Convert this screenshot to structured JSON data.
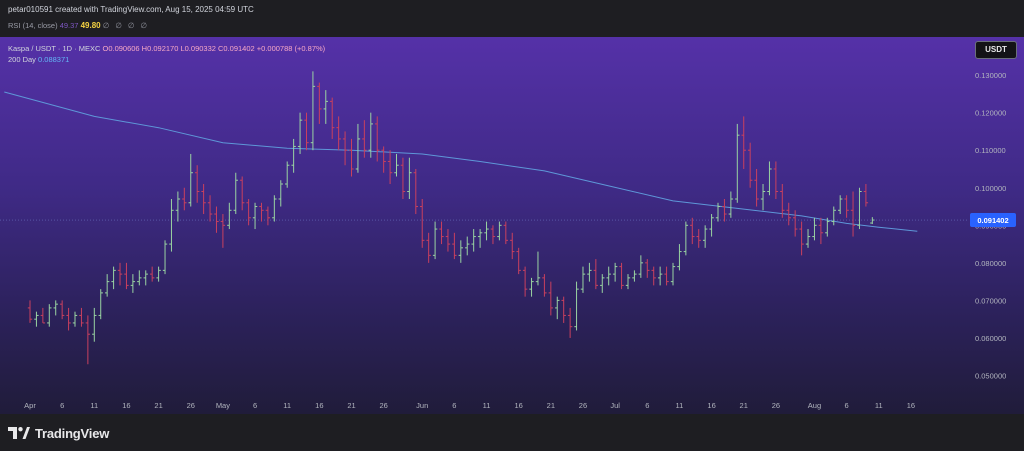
{
  "header": {
    "credit": "petar010591 created with TradingView.com, Aug 15, 2025 04:59 UTC",
    "rsi_label": "RSI (14, close)",
    "rsi_value_1": "49.37",
    "rsi_value_2": "49.80",
    "rsi_empty": "∅ ∅ ∅ ∅"
  },
  "legend": {
    "symbol": "Kaspa / USDT · 1D · MEXC",
    "ohlc": "O0.090606 H0.092170 L0.090332 C0.091402 +0.000788 (+0.87%)",
    "ma_label": "200 Day",
    "ma_value": "0.088371"
  },
  "currency_button": "USDT",
  "footer": {
    "brand": "TradingView"
  },
  "colors": {
    "bull": "#9ad4a2",
    "bear": "#c9405e",
    "ma": "#5e97d8",
    "price_tag": "#2962ff",
    "axis_text": "#b2b5be"
  },
  "chart_data": {
    "type": "ohlc",
    "title": "Kaspa / USDT · 1D · MEXC",
    "ylim": [
      0.045,
      0.135
    ],
    "y_ticks": [
      "0.050000",
      "0.060000",
      "0.070000",
      "0.080000",
      "0.090000",
      "0.100000",
      "0.110000",
      "0.120000",
      "0.130000"
    ],
    "y_tick_values": [
      0.05,
      0.06,
      0.07,
      0.08,
      0.09,
      0.1,
      0.11,
      0.12,
      0.13
    ],
    "x_ticks": [
      "Apr",
      "6",
      "11",
      "16",
      "21",
      "26",
      "May",
      "6",
      "11",
      "16",
      "21",
      "26",
      "Jun",
      "6",
      "11",
      "16",
      "21",
      "26",
      "Jul",
      "6",
      "11",
      "16",
      "21",
      "26",
      "Aug",
      "6",
      "11",
      "16"
    ],
    "x_tick_days": [
      0,
      5,
      10,
      15,
      20,
      25,
      30,
      35,
      40,
      45,
      50,
      55,
      61,
      66,
      71,
      76,
      81,
      86,
      91,
      96,
      101,
      106,
      111,
      116,
      122,
      127,
      132,
      137
    ],
    "last_price": "0.091402",
    "last_price_value": 0.091402,
    "ma_200": [
      [
        -4,
        0.1255
      ],
      [
        10,
        0.119
      ],
      [
        20,
        0.116
      ],
      [
        30,
        0.112
      ],
      [
        40,
        0.1105
      ],
      [
        50,
        0.11
      ],
      [
        61,
        0.109
      ],
      [
        70,
        0.107
      ],
      [
        80,
        0.1045
      ],
      [
        90,
        0.1005
      ],
      [
        100,
        0.0965
      ],
      [
        110,
        0.0945
      ],
      [
        120,
        0.0925
      ],
      [
        127,
        0.0905
      ],
      [
        132,
        0.0895
      ],
      [
        138,
        0.0884
      ]
    ],
    "candles": [
      [
        0.068,
        0.07,
        0.064,
        0.065
      ],
      [
        0.065,
        0.067,
        0.063,
        0.066
      ],
      [
        0.066,
        0.068,
        0.064,
        0.064
      ],
      [
        0.064,
        0.069,
        0.063,
        0.068
      ],
      [
        0.068,
        0.07,
        0.066,
        0.069
      ],
      [
        0.069,
        0.07,
        0.065,
        0.066
      ],
      [
        0.066,
        0.068,
        0.062,
        0.064
      ],
      [
        0.064,
        0.067,
        0.063,
        0.066
      ],
      [
        0.066,
        0.068,
        0.063,
        0.064
      ],
      [
        0.064,
        0.066,
        0.053,
        0.061
      ],
      [
        0.061,
        0.068,
        0.059,
        0.066
      ],
      [
        0.066,
        0.073,
        0.065,
        0.072
      ],
      [
        0.072,
        0.077,
        0.071,
        0.075
      ],
      [
        0.075,
        0.079,
        0.073,
        0.078
      ],
      [
        0.078,
        0.08,
        0.074,
        0.077
      ],
      [
        0.077,
        0.08,
        0.073,
        0.074
      ],
      [
        0.074,
        0.077,
        0.072,
        0.075
      ],
      [
        0.075,
        0.078,
        0.074,
        0.076
      ],
      [
        0.076,
        0.078,
        0.074,
        0.077
      ],
      [
        0.077,
        0.079,
        0.075,
        0.076
      ],
      [
        0.076,
        0.079,
        0.075,
        0.078
      ],
      [
        0.078,
        0.086,
        0.077,
        0.085
      ],
      [
        0.085,
        0.097,
        0.083,
        0.094
      ],
      [
        0.094,
        0.099,
        0.091,
        0.097
      ],
      [
        0.097,
        0.1,
        0.094,
        0.096
      ],
      [
        0.096,
        0.109,
        0.095,
        0.104
      ],
      [
        0.104,
        0.106,
        0.096,
        0.099
      ],
      [
        0.099,
        0.101,
        0.093,
        0.096
      ],
      [
        0.096,
        0.098,
        0.091,
        0.093
      ],
      [
        0.093,
        0.095,
        0.088,
        0.091
      ],
      [
        0.091,
        0.093,
        0.084,
        0.09
      ],
      [
        0.09,
        0.096,
        0.089,
        0.094
      ],
      [
        0.094,
        0.104,
        0.093,
        0.102
      ],
      [
        0.102,
        0.103,
        0.094,
        0.096
      ],
      [
        0.096,
        0.097,
        0.09,
        0.092
      ],
      [
        0.092,
        0.096,
        0.089,
        0.095
      ],
      [
        0.095,
        0.096,
        0.091,
        0.094
      ],
      [
        0.094,
        0.095,
        0.09,
        0.092
      ],
      [
        0.092,
        0.098,
        0.091,
        0.097
      ],
      [
        0.097,
        0.102,
        0.095,
        0.101
      ],
      [
        0.101,
        0.107,
        0.1,
        0.106
      ],
      [
        0.106,
        0.113,
        0.104,
        0.111
      ],
      [
        0.111,
        0.12,
        0.109,
        0.118
      ],
      [
        0.118,
        0.12,
        0.11,
        0.112
      ],
      [
        0.112,
        0.131,
        0.11,
        0.127
      ],
      [
        0.127,
        0.128,
        0.117,
        0.121
      ],
      [
        0.121,
        0.126,
        0.117,
        0.123
      ],
      [
        0.123,
        0.124,
        0.113,
        0.116
      ],
      [
        0.116,
        0.119,
        0.11,
        0.113
      ],
      [
        0.113,
        0.115,
        0.106,
        0.11
      ],
      [
        0.11,
        0.113,
        0.103,
        0.105
      ],
      [
        0.105,
        0.117,
        0.104,
        0.113
      ],
      [
        0.113,
        0.118,
        0.108,
        0.11
      ],
      [
        0.11,
        0.12,
        0.108,
        0.117
      ],
      [
        0.117,
        0.119,
        0.107,
        0.11
      ],
      [
        0.11,
        0.111,
        0.104,
        0.107
      ],
      [
        0.107,
        0.11,
        0.101,
        0.104
      ],
      [
        0.104,
        0.109,
        0.103,
        0.106
      ],
      [
        0.106,
        0.108,
        0.097,
        0.099
      ],
      [
        0.099,
        0.108,
        0.097,
        0.104
      ],
      [
        0.104,
        0.105,
        0.093,
        0.095
      ],
      [
        0.095,
        0.097,
        0.084,
        0.086
      ],
      [
        0.086,
        0.088,
        0.08,
        0.082
      ],
      [
        0.082,
        0.091,
        0.081,
        0.089
      ],
      [
        0.089,
        0.091,
        0.085,
        0.087
      ],
      [
        0.087,
        0.089,
        0.083,
        0.085
      ],
      [
        0.085,
        0.088,
        0.081,
        0.082
      ],
      [
        0.082,
        0.086,
        0.08,
        0.084
      ],
      [
        0.084,
        0.087,
        0.082,
        0.085
      ],
      [
        0.085,
        0.089,
        0.083,
        0.087
      ],
      [
        0.087,
        0.089,
        0.084,
        0.088
      ],
      [
        0.088,
        0.091,
        0.086,
        0.089
      ],
      [
        0.089,
        0.09,
        0.085,
        0.087
      ],
      [
        0.087,
        0.091,
        0.086,
        0.09
      ],
      [
        0.09,
        0.091,
        0.085,
        0.086
      ],
      [
        0.086,
        0.088,
        0.081,
        0.083
      ],
      [
        0.083,
        0.084,
        0.077,
        0.078
      ],
      [
        0.078,
        0.079,
        0.071,
        0.073
      ],
      [
        0.073,
        0.076,
        0.071,
        0.075
      ],
      [
        0.075,
        0.083,
        0.074,
        0.076
      ],
      [
        0.076,
        0.077,
        0.071,
        0.072
      ],
      [
        0.072,
        0.075,
        0.066,
        0.068
      ],
      [
        0.068,
        0.071,
        0.065,
        0.07
      ],
      [
        0.07,
        0.071,
        0.064,
        0.066
      ],
      [
        0.066,
        0.068,
        0.06,
        0.063
      ],
      [
        0.063,
        0.075,
        0.062,
        0.073
      ],
      [
        0.073,
        0.079,
        0.072,
        0.077
      ],
      [
        0.077,
        0.08,
        0.075,
        0.078
      ],
      [
        0.078,
        0.081,
        0.073,
        0.074
      ],
      [
        0.074,
        0.077,
        0.072,
        0.076
      ],
      [
        0.076,
        0.079,
        0.074,
        0.077
      ],
      [
        0.077,
        0.08,
        0.075,
        0.079
      ],
      [
        0.079,
        0.08,
        0.073,
        0.074
      ],
      [
        0.074,
        0.077,
        0.073,
        0.076
      ],
      [
        0.076,
        0.078,
        0.075,
        0.077
      ],
      [
        0.077,
        0.082,
        0.076,
        0.08
      ],
      [
        0.08,
        0.081,
        0.076,
        0.078
      ],
      [
        0.078,
        0.079,
        0.074,
        0.076
      ],
      [
        0.076,
        0.079,
        0.074,
        0.077
      ],
      [
        0.077,
        0.079,
        0.074,
        0.075
      ],
      [
        0.075,
        0.08,
        0.074,
        0.079
      ],
      [
        0.079,
        0.085,
        0.078,
        0.083
      ],
      [
        0.083,
        0.091,
        0.082,
        0.09
      ],
      [
        0.09,
        0.092,
        0.085,
        0.087
      ],
      [
        0.087,
        0.089,
        0.084,
        0.086
      ],
      [
        0.086,
        0.09,
        0.084,
        0.089
      ],
      [
        0.089,
        0.093,
        0.087,
        0.092
      ],
      [
        0.092,
        0.096,
        0.091,
        0.095
      ],
      [
        0.095,
        0.097,
        0.091,
        0.093
      ],
      [
        0.093,
        0.099,
        0.092,
        0.097
      ],
      [
        0.097,
        0.117,
        0.096,
        0.114
      ],
      [
        0.114,
        0.119,
        0.105,
        0.11
      ],
      [
        0.11,
        0.112,
        0.1,
        0.102
      ],
      [
        0.102,
        0.105,
        0.095,
        0.097
      ],
      [
        0.097,
        0.101,
        0.094,
        0.099
      ],
      [
        0.099,
        0.107,
        0.098,
        0.105
      ],
      [
        0.105,
        0.107,
        0.097,
        0.099
      ],
      [
        0.099,
        0.101,
        0.092,
        0.094
      ],
      [
        0.094,
        0.096,
        0.09,
        0.092
      ],
      [
        0.092,
        0.094,
        0.087,
        0.089
      ],
      [
        0.089,
        0.091,
        0.082,
        0.085
      ],
      [
        0.085,
        0.089,
        0.084,
        0.087
      ],
      [
        0.087,
        0.092,
        0.086,
        0.09
      ],
      [
        0.09,
        0.092,
        0.085,
        0.088
      ],
      [
        0.088,
        0.092,
        0.087,
        0.091
      ],
      [
        0.091,
        0.095,
        0.09,
        0.094
      ],
      [
        0.094,
        0.098,
        0.093,
        0.097
      ],
      [
        0.097,
        0.098,
        0.092,
        0.094
      ],
      [
        0.094,
        0.099,
        0.087,
        0.09
      ],
      [
        0.09,
        0.1,
        0.089,
        0.099
      ],
      [
        0.099,
        0.101,
        0.095,
        0.096
      ],
      [
        0.090606,
        0.09217,
        0.090332,
        0.091402
      ]
    ]
  }
}
